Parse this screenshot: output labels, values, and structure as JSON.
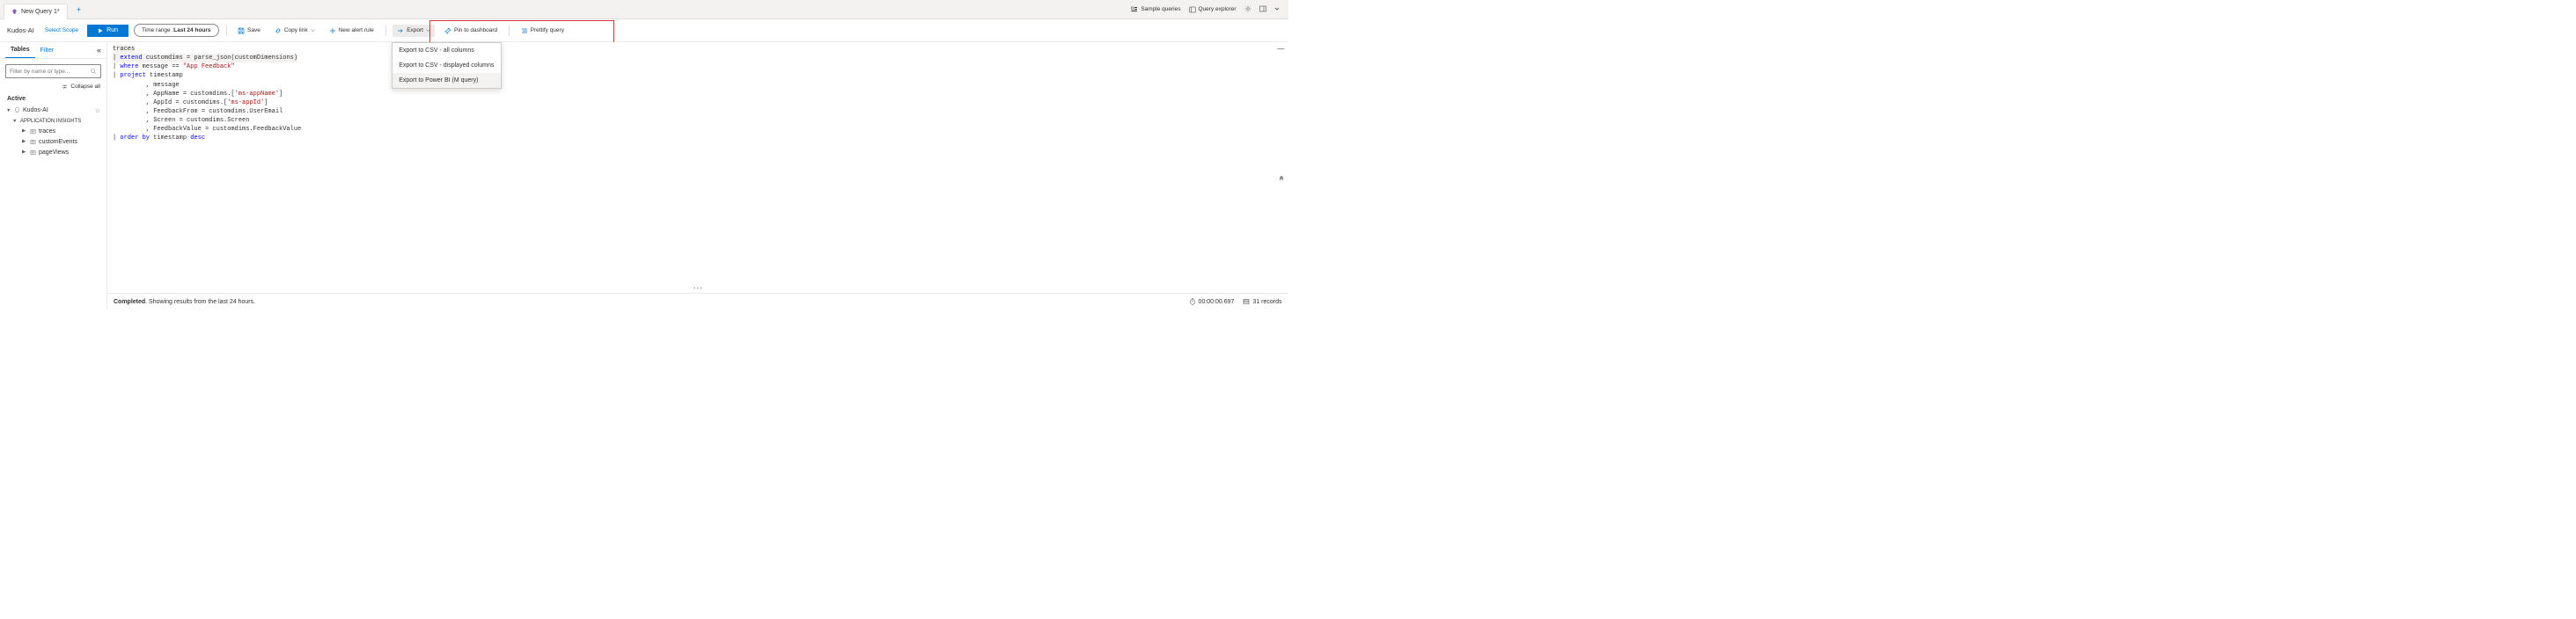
{
  "tabs": {
    "active": "New Query 1*"
  },
  "header_links": {
    "sample": "Sample queries",
    "explorer": "Query explorer"
  },
  "toolbar": {
    "scope_name": "Kudos-AI",
    "select_scope": "Select Scope",
    "run": "Run",
    "time_prefix": "Time range : ",
    "time_value": "Last 24 hours",
    "save": "Save",
    "copy_link": "Copy link",
    "new_alert": "New alert rule",
    "export": "Export",
    "pin": "Pin to dashboard",
    "prettify": "Prettify query"
  },
  "export_menu": {
    "csv_all": "Export to CSV - all columns",
    "csv_disp": "Export to CSV - displayed columns",
    "powerbi": "Export to Power BI (M query)",
    "tooltip": "Export to Power BI (M query)"
  },
  "sidebar": {
    "tabs": {
      "tables": "Tables",
      "filter": "Filter"
    },
    "search_placeholder": "Filter by name or type...",
    "collapse_all": "Collapse all",
    "group": "Active",
    "root": "Kudos-AI",
    "category": "APPLICATION INSIGHTS",
    "items": [
      "traces",
      "customEvents",
      "pageViews"
    ]
  },
  "code_lines": [
    {
      "t": "traces",
      "plain": true,
      "current": true
    },
    {
      "pipe": true,
      "kw": "extend",
      "rest": " customdims = parse_json(customDimensions)",
      "current": true
    },
    {
      "pipe": true,
      "kw": "where",
      "rest": " message == ",
      "str": "\"App Feedback\""
    },
    {
      "pipe": true,
      "kw": "project",
      "rest": " timestamp"
    },
    {
      "cont": true,
      "rest": "       , message"
    },
    {
      "cont": true,
      "rest": "       , AppName = customdims.[",
      "str": "'ms-appName'",
      "tail": "]"
    },
    {
      "cont": true,
      "rest": "       , AppId = customdims.[",
      "str": "'ms-appId'",
      "tail": "]"
    },
    {
      "cont": true,
      "rest": "       , FeedbackFrom = customdims.UserEmail"
    },
    {
      "cont": true,
      "rest": "       , Screen = customdims.Screen"
    },
    {
      "cont": true,
      "rest": "       , FeedbackValue = customdims.FeedbackValue"
    },
    {
      "pipe": true,
      "kw": "order by",
      "rest": " timestamp ",
      "kw2": "desc"
    }
  ],
  "status": {
    "prefix": "Completed",
    "text": ". Showing results from the last 24 hours.",
    "duration": "00:00:00.697",
    "records": "31 records"
  }
}
